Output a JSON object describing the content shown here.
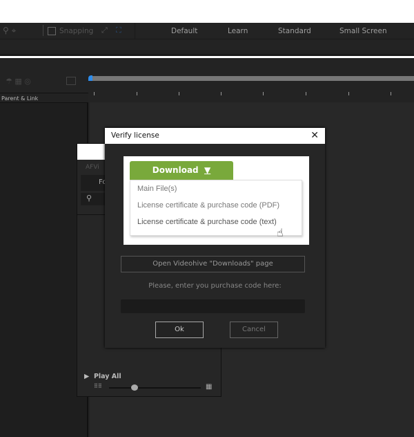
{
  "toolbar": {
    "snapping": "Snapping",
    "workspaces": [
      "Default",
      "Learn",
      "Standard",
      "Small Screen"
    ]
  },
  "timeline": {
    "column_header": "Parent & Link"
  },
  "background_panel": {
    "title_partial": "AFVi",
    "tab_partial": "Fo",
    "play_all": "Play All"
  },
  "dialog": {
    "title": "Verify license",
    "download_label": "Download",
    "menu_items": [
      "Main File(s)",
      "License certificate & purchase code (PDF)",
      "License certificate & purchase code (text)"
    ],
    "open_page_button": "Open Videohive \"Downloads\" page",
    "prompt": "Please, enter you purchase code here:",
    "purchase_code_value": "",
    "ok": "Ok",
    "cancel": "Cancel"
  },
  "colors": {
    "accent_green": "#79a93b",
    "playhead_blue": "#2d8ceb"
  }
}
